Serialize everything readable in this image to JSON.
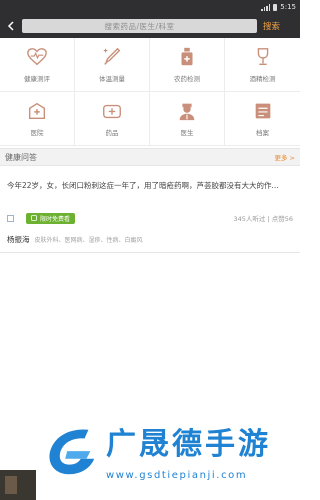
{
  "status_bar": {
    "time": "5:15"
  },
  "header": {
    "search_placeholder": "搜索药品/医生/科室",
    "search_button": "搜索"
  },
  "grid": {
    "items": [
      {
        "label": "健康测评",
        "icon": "heart-pulse-icon"
      },
      {
        "label": "体温测量",
        "icon": "thermometer-icon"
      },
      {
        "label": "农药检测",
        "icon": "pesticide-bottle-icon"
      },
      {
        "label": "酒精检测",
        "icon": "wine-glass-icon"
      },
      {
        "label": "医院",
        "icon": "hospital-icon"
      },
      {
        "label": "药品",
        "icon": "medicine-box-icon"
      },
      {
        "label": "医生",
        "icon": "doctor-icon"
      },
      {
        "label": "档案",
        "icon": "archive-icon"
      }
    ]
  },
  "section": {
    "title": "健康问答",
    "more": "更多 >"
  },
  "post": {
    "question": "今年22岁，女，长闭口粉刺这症一年了，用了暗疮药啊，芦荟胶都没有大大的作...",
    "badge": "限时免费看",
    "read_count": "345人听过 | 点赞56",
    "doctor_name": "杨振海",
    "doctor_tags": "皮肤外科、医网病、湿疹、性病、白癜风"
  },
  "watermark": {
    "title": "广晟德手游",
    "url": "www.gsdtiepianji.com"
  },
  "colors": {
    "accent": "#f0a346",
    "icon": "#c98f7a",
    "header_bg": "#2f2f31",
    "badge": "#6cb12f",
    "watermark": "#1f82d2"
  }
}
